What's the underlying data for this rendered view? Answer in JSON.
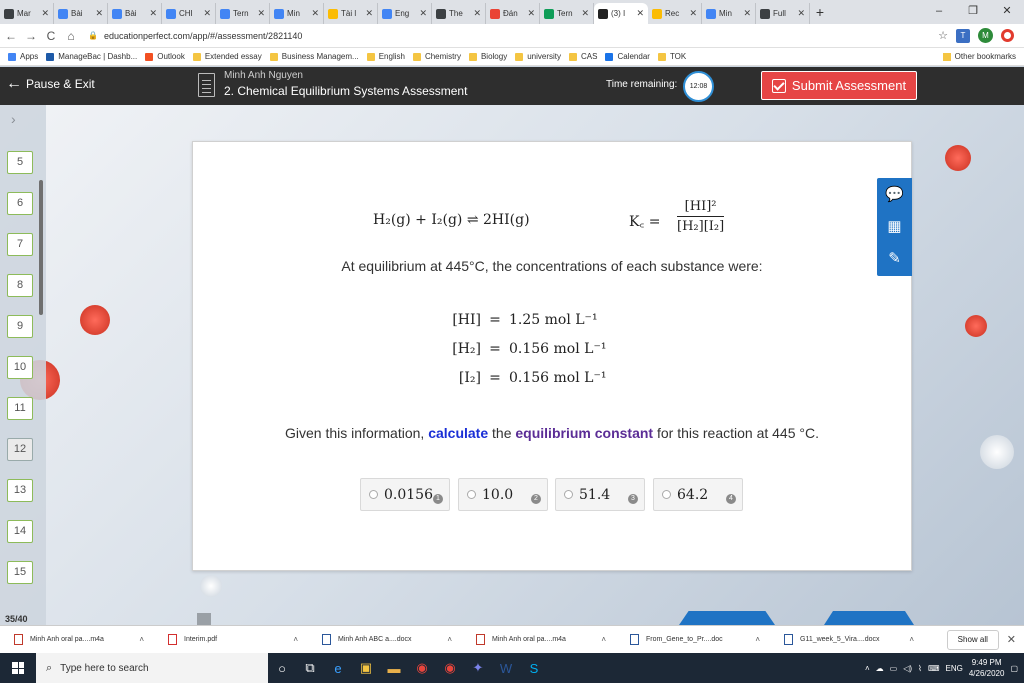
{
  "browser": {
    "tabs": [
      {
        "label": "Mar",
        "color": "#3c4043"
      },
      {
        "label": "Bài",
        "color": "#4285f4"
      },
      {
        "label": "Bài",
        "color": "#4285f4"
      },
      {
        "label": "CHI",
        "color": "#4285f4"
      },
      {
        "label": "Tern",
        "color": "#4285f4"
      },
      {
        "label": "Min",
        "color": "#4285f4"
      },
      {
        "label": "Tài l",
        "color": "#fbbc04"
      },
      {
        "label": "Eng",
        "color": "#4285f4"
      },
      {
        "label": "The",
        "color": "#3c4043"
      },
      {
        "label": "Đán",
        "color": "#ea4335"
      },
      {
        "label": "Tern",
        "color": "#0f9d58"
      },
      {
        "label": "(3) I",
        "color": "#222",
        "active": true
      },
      {
        "label": "Rec",
        "color": "#fbbc04"
      },
      {
        "label": "Min",
        "color": "#4285f4"
      },
      {
        "label": "Full",
        "color": "#3c4043"
      }
    ],
    "url": "educationperfect.com/app/#/assessment/2821140",
    "profile_initial": "M",
    "bookmarks": [
      {
        "label": "Apps",
        "color": "#4285f4"
      },
      {
        "label": "ManageBac | Dashb...",
        "color": "#1e5aa8"
      },
      {
        "label": "Outlook",
        "color": "#f25022"
      },
      {
        "label": "Extended essay",
        "color": "#f4c542"
      },
      {
        "label": "Business Managem...",
        "color": "#f4c542"
      },
      {
        "label": "English",
        "color": "#f4c542"
      },
      {
        "label": "Chemistry",
        "color": "#f4c542"
      },
      {
        "label": "Biology",
        "color": "#f4c542"
      },
      {
        "label": "university",
        "color": "#f4c542"
      },
      {
        "label": "CAS",
        "color": "#f4c542"
      },
      {
        "label": "Calendar",
        "color": "#1a73e8"
      },
      {
        "label": "TOK",
        "color": "#f4c542"
      }
    ],
    "other_bookmarks": "Other bookmarks"
  },
  "header": {
    "pause_exit": "Pause & Exit",
    "student_name": "Minh Anh Nguyen",
    "assessment_title": "2. Chemical Equilibrium Systems Assessment",
    "time_label": "Time remaining:",
    "time_value": "12:08",
    "submit_label": "Submit Assessment"
  },
  "sidebar": {
    "questions": [
      "5",
      "6",
      "7",
      "8",
      "9",
      "10",
      "11",
      "12",
      "13",
      "14",
      "15"
    ],
    "current": "12",
    "progress": "35/40"
  },
  "question": {
    "equation": "H₂(g) + I₂(g) ⇌ 2HI(g)",
    "kc_label": "K꜀ =",
    "kc_numerator": "[HI]²",
    "kc_denominator": "[H₂][I₂]",
    "intro": "At equilibrium at 445°C, the concentrations of each substance were:",
    "concentrations": [
      {
        "species": "[HI]",
        "value": "1.25 mol L⁻¹"
      },
      {
        "species": "[H₂]",
        "value": "0.156 mol L⁻¹"
      },
      {
        "species": "[I₂]",
        "value": "0.156 mol L⁻¹"
      }
    ],
    "instruction_pre": "Given this information,",
    "instruction_calc": "calculate",
    "instruction_mid": "the",
    "instruction_term": "equilibrium constant",
    "instruction_post": "for this reaction at 445 °C.",
    "options": [
      {
        "value": "0.0156",
        "key": "1"
      },
      {
        "value": "10.0",
        "key": "2"
      },
      {
        "value": "51.4",
        "key": "3"
      },
      {
        "value": "64.2",
        "key": "4"
      }
    ]
  },
  "tools": [
    "speech-icon",
    "calculator-icon",
    "pen-icon"
  ],
  "downloads": {
    "items": [
      {
        "name": "Minh Anh oral pa....m4a",
        "color": "#c0392b"
      },
      {
        "name": "Interim.pdf",
        "color": "#d32f2f"
      },
      {
        "name": "Minh Anh ABC a....docx",
        "color": "#2b579a"
      },
      {
        "name": "Minh Anh oral pa....m4a",
        "color": "#c0392b"
      },
      {
        "name": "From_Gene_to_Pr....doc",
        "color": "#2b579a"
      },
      {
        "name": "G11_week_5_Vira....docx",
        "color": "#2b579a"
      }
    ],
    "show_all": "Show all"
  },
  "taskbar": {
    "search_placeholder": "Type here to search",
    "lang": "ENG",
    "time": "9:49 PM",
    "date": "4/26/2020"
  }
}
